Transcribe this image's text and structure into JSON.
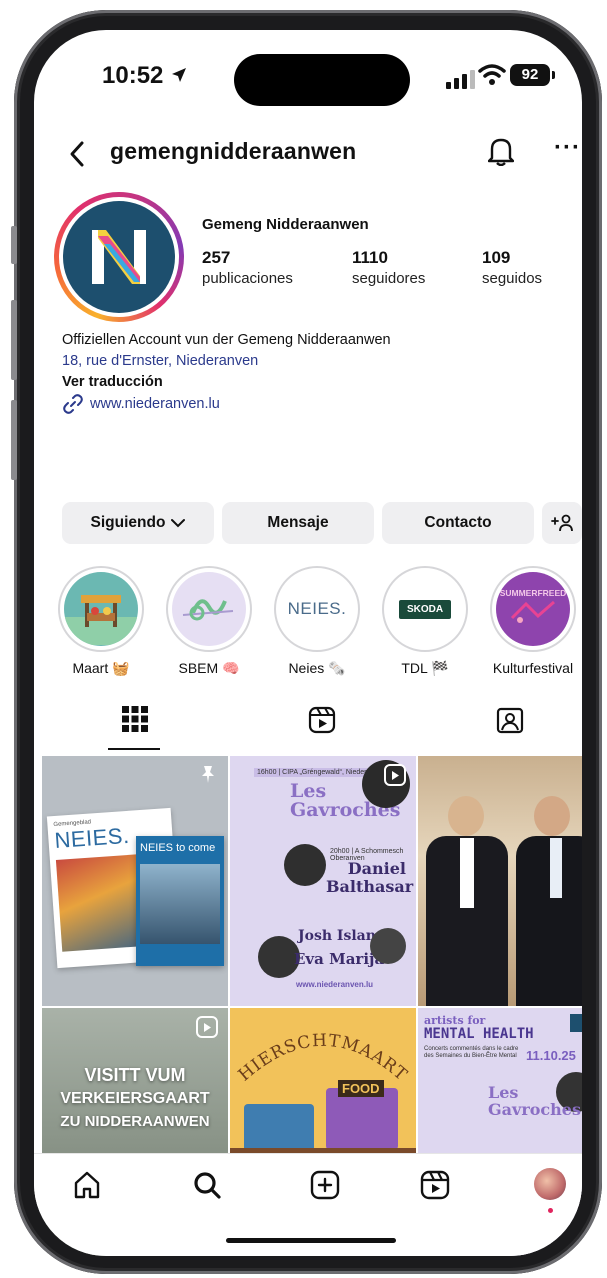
{
  "status": {
    "time": "10:52",
    "battery": "92"
  },
  "header": {
    "username": "gemengnidderaanwen",
    "more_label": "···"
  },
  "profile": {
    "display_name": "Gemeng Nidderaanwen",
    "stats": [
      {
        "value": "257",
        "label": "publicaciones"
      },
      {
        "value": "1110",
        "label": "seguidores"
      },
      {
        "value": "109",
        "label": "seguidos"
      }
    ],
    "bio_line": "Offiziellen Account vun der Gemeng Nidderaanwen",
    "address": "18, rue d'Ernster, Niederanven",
    "translate": "Ver traducción",
    "website": "www.niederanven.lu"
  },
  "actions": {
    "following": "Siguiendo",
    "message": "Mensaje",
    "contact": "Contacto",
    "add_person": "+ₕ"
  },
  "highlights": [
    {
      "label": "Maart 🧺",
      "icon": "market-stall-image"
    },
    {
      "label": "SBEM 🧠",
      "icon": "ribbon-image"
    },
    {
      "label": "Neies 🗞️",
      "icon": "neies-logo-image"
    },
    {
      "label": "TDL 🏁",
      "icon": "skoda-logo-image"
    },
    {
      "label": "Kulturfestival",
      "icon": "summerfreed-image"
    }
  ],
  "highlight_texts": {
    "neies": "NEIES.",
    "skoda": "SKODA",
    "summer": "SUMMERFREED"
  },
  "posts": {
    "p1": {
      "a": "Gemengeblad",
      "b": "NEIES.",
      "c": "NEIES to come"
    },
    "p2": {
      "t1": "16h00 | CIPA „Gréngewald“, Niederanven",
      "t2": "Les Gavroches",
      "t3": "20h00 | A Schommesch Oberanven",
      "t4": "Daniel Balthasar",
      "t5": "Josh Island",
      "t6": "Eva Marija",
      "t7": "www.niederanven.lu"
    },
    "p4": {
      "t1": "VISITT VUM",
      "t2": "VERKEIERSGAART",
      "t3": "ZU NIDDERAANWEN"
    },
    "p5": {
      "t1": "HIERSCHTMAART",
      "t2": "FOOD"
    },
    "p6": {
      "t1": "artists for",
      "t2": "MENTAL HEALTH",
      "t3": "Concerts commentés dans le cadre des Semaines du Bien-Être Mental",
      "t4": "11.10.25",
      "t5": "Les Gavroches"
    }
  },
  "colors": {
    "accent_link": "#2b3a8c",
    "button_bg": "#efeff1",
    "post_lavender": "#ded7f0",
    "post_yellow": "#f2c25a"
  }
}
